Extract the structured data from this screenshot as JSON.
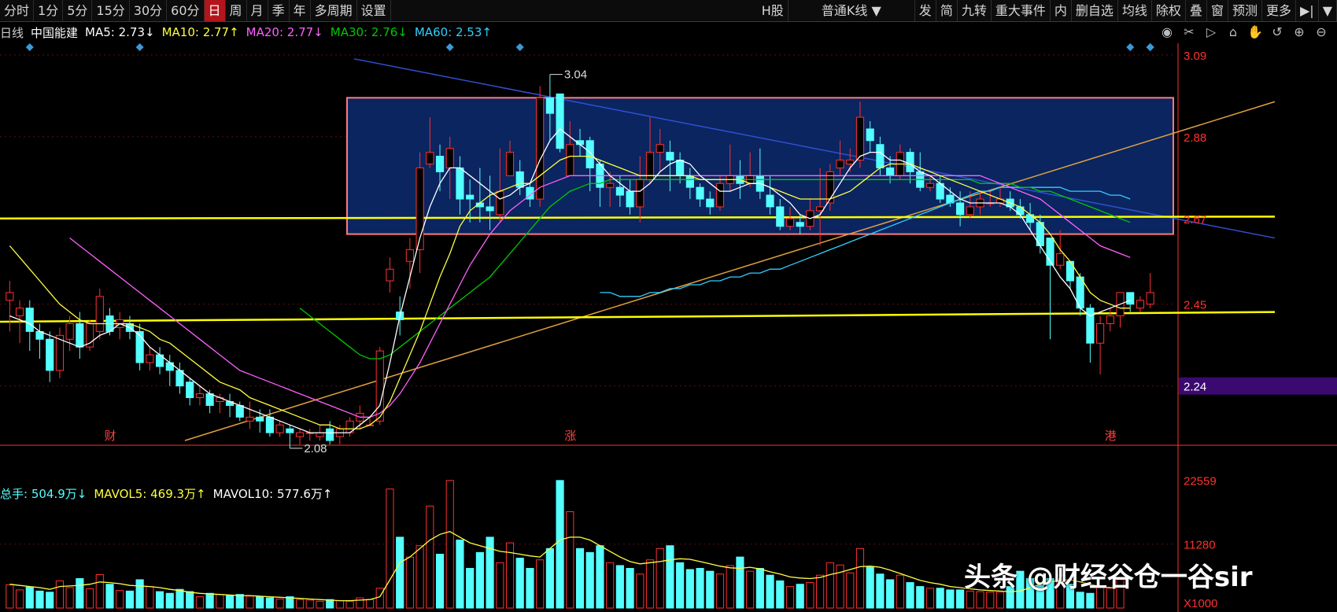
{
  "toolbar": {
    "left": [
      "分时",
      "1分",
      "5分",
      "15分",
      "30分",
      "60分",
      "日",
      "周",
      "月",
      "季",
      "年",
      "多周期",
      "设置"
    ],
    "active": "日",
    "market": "H股",
    "kline_type": "普通K线",
    "right": [
      "发",
      "简",
      "九转",
      "重大事件",
      "内",
      "删自选",
      "均线",
      "除权",
      "叠",
      "窗",
      "预测",
      "更多"
    ]
  },
  "legend": {
    "period": "日线",
    "stock": "中国能建",
    "ma5": "MA5: 2.73↓",
    "ma10": "MA10: 2.77↑",
    "ma20": "MA20: 2.77↓",
    "ma30": "MA30: 2.76↓",
    "ma60": "MA60: 2.53↑"
  },
  "vol_legend": {
    "total": "总手: 504.9万↓",
    "mavol5": "MAVOL5: 469.3万↑",
    "mavol10": "MAVOL10: 577.6万↑"
  },
  "colors": {
    "up": "#ff3030",
    "down": "#54ffff",
    "ma5": "#ffffff",
    "ma10": "#ffff40",
    "ma20": "#ff60ff",
    "ma30": "#00c800",
    "ma60": "#30d0ff",
    "box": "#0a2560",
    "box_border": "#ff7a7a",
    "hline": "#ffff00",
    "axis": "#ff3030"
  },
  "events": [
    "财",
    "涨",
    "港"
  ],
  "watermark": "头条 @财经谷仓一谷sir",
  "chart_data": {
    "type": "candlestick",
    "price_axis": {
      "ticks": [
        3.09,
        2.88,
        2.67,
        2.45,
        2.24
      ],
      "ylim": [
        2.1,
        3.12
      ],
      "highlight": 2.24
    },
    "volume_axis": {
      "ticks": [
        22559,
        11280
      ],
      "unit": "X1000"
    },
    "annotations": [
      {
        "label": "3.04",
        "value": 3.04
      },
      {
        "label": "2.08",
        "value": 2.08
      }
    ],
    "candles": [
      [
        2.46,
        2.48,
        2.51,
        2.38
      ],
      [
        2.42,
        2.44,
        2.46,
        2.35
      ],
      [
        2.44,
        2.38,
        2.46,
        2.33
      ],
      [
        2.38,
        2.36,
        2.4,
        2.31
      ],
      [
        2.36,
        2.28,
        2.38,
        2.25
      ],
      [
        2.28,
        2.37,
        2.39,
        2.26
      ],
      [
        2.36,
        2.4,
        2.42,
        2.33
      ],
      [
        2.4,
        2.34,
        2.43,
        2.31
      ],
      [
        2.34,
        2.4,
        2.41,
        2.33
      ],
      [
        2.38,
        2.47,
        2.49,
        2.36
      ],
      [
        2.42,
        2.38,
        2.44,
        2.37
      ],
      [
        2.39,
        2.41,
        2.43,
        2.36
      ],
      [
        2.4,
        2.38,
        2.42,
        2.36
      ],
      [
        2.38,
        2.3,
        2.4,
        2.28
      ],
      [
        2.3,
        2.32,
        2.34,
        2.28
      ],
      [
        2.32,
        2.29,
        2.34,
        2.27
      ],
      [
        2.3,
        2.28,
        2.32,
        2.24
      ],
      [
        2.28,
        2.24,
        2.3,
        2.22
      ],
      [
        2.25,
        2.21,
        2.26,
        2.19
      ],
      [
        2.21,
        2.22,
        2.24,
        2.19
      ],
      [
        2.22,
        2.19,
        2.23,
        2.17
      ],
      [
        2.2,
        2.21,
        2.22,
        2.17
      ],
      [
        2.2,
        2.19,
        2.22,
        2.16
      ],
      [
        2.19,
        2.16,
        2.2,
        2.15
      ],
      [
        2.15,
        2.16,
        2.2,
        2.13
      ],
      [
        2.16,
        2.15,
        2.18,
        2.12
      ],
      [
        2.16,
        2.12,
        2.18,
        2.11
      ],
      [
        2.12,
        2.14,
        2.15,
        2.11
      ],
      [
        2.13,
        2.12,
        2.14,
        2.08
      ],
      [
        2.11,
        2.12,
        2.13,
        2.09
      ],
      [
        2.12,
        2.12,
        2.13,
        2.1
      ],
      [
        2.11,
        2.12,
        2.14,
        2.1
      ],
      [
        2.13,
        2.1,
        2.15,
        2.09
      ],
      [
        2.11,
        2.13,
        2.14,
        2.09
      ],
      [
        2.12,
        2.15,
        2.16,
        2.11
      ],
      [
        2.15,
        2.17,
        2.19,
        2.13
      ],
      [
        2.14,
        2.14,
        2.16,
        2.14
      ],
      [
        2.15,
        2.33,
        2.34,
        2.14
      ],
      [
        2.51,
        2.54,
        2.57,
        2.48
      ],
      [
        2.43,
        2.41,
        2.47,
        2.37
      ],
      [
        2.56,
        2.59,
        2.62,
        2.49
      ],
      [
        2.59,
        2.8,
        2.84,
        2.53
      ],
      [
        2.81,
        2.84,
        2.93,
        2.8
      ],
      [
        2.83,
        2.79,
        2.86,
        2.74
      ],
      [
        2.8,
        2.85,
        2.88,
        2.72
      ],
      [
        2.8,
        2.72,
        2.83,
        2.68
      ],
      [
        2.73,
        2.72,
        2.77,
        2.66
      ],
      [
        2.71,
        2.7,
        2.8,
        2.66
      ],
      [
        2.7,
        2.69,
        2.78,
        2.64
      ],
      [
        2.68,
        2.74,
        2.85,
        2.66
      ],
      [
        2.78,
        2.84,
        2.87,
        2.78
      ],
      [
        2.79,
        2.75,
        2.82,
        2.73
      ],
      [
        2.75,
        2.72,
        2.76,
        2.7
      ],
      [
        2.72,
        2.98,
        3.01,
        2.7
      ],
      [
        2.98,
        2.94,
        3.04,
        2.87
      ],
      [
        2.99,
        2.85,
        2.99,
        2.84
      ],
      [
        2.78,
        2.86,
        2.92,
        2.78
      ],
      [
        2.87,
        2.86,
        2.9,
        2.83
      ],
      [
        2.87,
        2.8,
        2.88,
        2.74
      ],
      [
        2.81,
        2.75,
        2.82,
        2.7
      ],
      [
        2.75,
        2.76,
        2.79,
        2.7
      ],
      [
        2.75,
        2.73,
        2.78,
        2.7
      ],
      [
        2.74,
        2.7,
        2.77,
        2.68
      ],
      [
        2.7,
        2.77,
        2.83,
        2.66
      ],
      [
        2.77,
        2.84,
        2.93,
        2.76
      ],
      [
        2.84,
        2.86,
        2.9,
        2.79
      ],
      [
        2.84,
        2.82,
        2.87,
        2.74
      ],
      [
        2.82,
        2.78,
        2.84,
        2.76
      ],
      [
        2.78,
        2.75,
        2.8,
        2.72
      ],
      [
        2.75,
        2.72,
        2.76,
        2.7
      ],
      [
        2.72,
        2.7,
        2.74,
        2.68
      ],
      [
        2.7,
        2.76,
        2.78,
        2.69
      ],
      [
        2.76,
        2.78,
        2.86,
        2.74
      ],
      [
        2.78,
        2.76,
        2.82,
        2.72
      ],
      [
        2.76,
        2.78,
        2.84,
        2.75
      ],
      [
        2.78,
        2.74,
        2.85,
        2.72
      ],
      [
        2.73,
        2.7,
        2.78,
        2.68
      ],
      [
        2.7,
        2.65,
        2.72,
        2.64
      ],
      [
        2.65,
        2.67,
        2.7,
        2.64
      ],
      [
        2.66,
        2.65,
        2.68,
        2.63
      ],
      [
        2.65,
        2.69,
        2.72,
        2.64
      ],
      [
        2.69,
        2.7,
        2.8,
        2.6
      ],
      [
        2.71,
        2.79,
        2.81,
        2.69
      ],
      [
        2.8,
        2.82,
        2.87,
        2.78
      ],
      [
        2.81,
        2.82,
        2.85,
        2.79
      ],
      [
        2.82,
        2.93,
        2.97,
        2.8
      ],
      [
        2.9,
        2.87,
        2.92,
        2.84
      ],
      [
        2.86,
        2.8,
        2.88,
        2.78
      ],
      [
        2.8,
        2.78,
        2.83,
        2.76
      ],
      [
        2.78,
        2.84,
        2.86,
        2.77
      ],
      [
        2.84,
        2.79,
        2.85,
        2.76
      ],
      [
        2.79,
        2.75,
        2.84,
        2.74
      ],
      [
        2.75,
        2.76,
        2.78,
        2.74
      ],
      [
        2.76,
        2.72,
        2.78,
        2.71
      ],
      [
        2.73,
        2.71,
        2.75,
        2.7
      ],
      [
        2.71,
        2.68,
        2.74,
        2.65
      ],
      [
        2.68,
        2.7,
        2.74,
        2.67
      ],
      [
        2.7,
        2.72,
        2.74,
        2.68
      ],
      [
        2.71,
        2.71,
        2.74,
        2.7
      ],
      [
        2.71,
        2.72,
        2.75,
        2.7
      ],
      [
        2.72,
        2.7,
        2.74,
        2.69
      ],
      [
        2.7,
        2.68,
        2.72,
        2.67
      ],
      [
        2.68,
        2.66,
        2.71,
        2.64
      ],
      [
        2.66,
        2.6,
        2.68,
        2.58
      ],
      [
        2.62,
        2.55,
        2.6,
        2.36
      ],
      [
        2.55,
        2.58,
        2.64,
        2.54
      ],
      [
        2.56,
        2.51,
        2.56,
        2.49
      ],
      [
        2.52,
        2.44,
        2.53,
        2.42
      ],
      [
        2.44,
        2.35,
        2.45,
        2.3
      ],
      [
        2.35,
        2.4,
        2.42,
        2.27
      ],
      [
        2.4,
        2.42,
        2.44,
        2.38
      ],
      [
        2.42,
        2.48,
        2.48,
        2.39
      ],
      [
        2.48,
        2.45,
        2.48,
        2.43
      ],
      [
        2.44,
        2.46,
        2.47,
        2.43
      ],
      [
        2.45,
        2.48,
        2.53,
        2.44
      ]
    ],
    "volumes": [
      4100,
      3200,
      3700,
      3000,
      2800,
      4800,
      3600,
      5200,
      3400,
      5900,
      4200,
      3100,
      3000,
      5000,
      3800,
      2900,
      2600,
      3300,
      2900,
      2000,
      2600,
      2400,
      2200,
      2400,
      2100,
      2000,
      1800,
      1600,
      2000,
      1500,
      1400,
      1200,
      1500,
      1300,
      1200,
      1800,
      1500,
      3500,
      21000,
      12500,
      9000,
      11000,
      18000,
      9500,
      22500,
      12000,
      7000,
      9800,
      12500,
      8000,
      11500,
      8800,
      7000,
      8500,
      10500,
      22500,
      17000,
      10500,
      9800,
      11000,
      8000,
      7500,
      7000,
      6000,
      8500,
      10500,
      11000,
      8000,
      6800,
      7000,
      6500,
      6000,
      7500,
      9000,
      6500,
      7000,
      5800,
      4800,
      3800,
      4200,
      4500,
      5800,
      8000,
      7600,
      6200,
      10500,
      7200,
      6000,
      5000,
      5800,
      4500,
      3800,
      3500,
      3500,
      3200,
      3200,
      3000,
      2900,
      2800,
      2800,
      3800,
      6500,
      5200,
      4000,
      5200,
      5800,
      4200,
      2800,
      2600,
      3900,
      3500,
      5000
    ],
    "ma5": [
      2.42,
      2.41,
      2.4,
      2.38,
      2.37,
      2.36,
      2.35,
      2.34,
      2.35,
      2.37,
      2.38,
      2.4,
      2.39,
      2.37,
      2.34,
      2.32,
      2.3,
      2.28,
      2.26,
      2.24,
      2.22,
      2.21,
      2.2,
      2.19,
      2.18,
      2.17,
      2.16,
      2.15,
      2.14,
      2.13,
      2.12,
      2.12,
      2.12,
      2.12,
      2.12,
      2.14,
      2.16,
      2.19,
      2.3,
      2.42,
      2.52,
      2.62,
      2.7,
      2.76,
      2.8,
      2.8,
      2.78,
      2.76,
      2.74,
      2.72,
      2.73,
      2.75,
      2.76,
      2.82,
      2.87,
      2.9,
      2.88,
      2.86,
      2.84,
      2.81,
      2.78,
      2.76,
      2.74,
      2.74,
      2.76,
      2.79,
      2.81,
      2.82,
      2.81,
      2.78,
      2.76,
      2.74,
      2.74,
      2.75,
      2.76,
      2.76,
      2.75,
      2.73,
      2.71,
      2.68,
      2.67,
      2.68,
      2.72,
      2.76,
      2.8,
      2.83,
      2.84,
      2.84,
      2.82,
      2.82,
      2.81,
      2.79,
      2.78,
      2.76,
      2.74,
      2.72,
      2.71,
      2.71,
      2.71,
      2.71,
      2.7,
      2.68,
      2.64,
      2.6,
      2.56,
      2.52,
      2.49,
      2.44,
      2.42,
      2.43,
      2.44,
      2.45,
      2.46
    ],
    "ma10": [
      2.6,
      2.57,
      2.54,
      2.51,
      2.48,
      2.45,
      2.43,
      2.41,
      2.4,
      2.4,
      2.4,
      2.4,
      2.4,
      2.39,
      2.38,
      2.36,
      2.35,
      2.33,
      2.31,
      2.29,
      2.27,
      2.25,
      2.24,
      2.23,
      2.21,
      2.2,
      2.19,
      2.18,
      2.17,
      2.16,
      2.15,
      2.14,
      2.14,
      2.13,
      2.13,
      2.13,
      2.14,
      2.16,
      2.2,
      2.26,
      2.32,
      2.38,
      2.45,
      2.52,
      2.58,
      2.65,
      2.69,
      2.71,
      2.73,
      2.74,
      2.75,
      2.76,
      2.76,
      2.78,
      2.8,
      2.82,
      2.83,
      2.83,
      2.83,
      2.82,
      2.81,
      2.8,
      2.79,
      2.78,
      2.78,
      2.78,
      2.78,
      2.78,
      2.78,
      2.77,
      2.77,
      2.77,
      2.77,
      2.77,
      2.76,
      2.76,
      2.75,
      2.74,
      2.73,
      2.72,
      2.72,
      2.72,
      2.72,
      2.73,
      2.74,
      2.76,
      2.78,
      2.8,
      2.81,
      2.81,
      2.81,
      2.8,
      2.79,
      2.78,
      2.77,
      2.76,
      2.75,
      2.74,
      2.73,
      2.72,
      2.71,
      2.7,
      2.68,
      2.66,
      2.63,
      2.59,
      2.56,
      2.52,
      2.48,
      2.46,
      2.45,
      2.44,
      2.44
    ],
    "ma20": [
      null,
      null,
      null,
      null,
      null,
      null,
      2.62,
      2.6,
      2.58,
      2.56,
      2.54,
      2.52,
      2.5,
      2.48,
      2.46,
      2.44,
      2.42,
      2.4,
      2.38,
      2.36,
      2.34,
      2.32,
      2.3,
      2.28,
      2.27,
      2.26,
      2.25,
      2.24,
      2.23,
      2.22,
      2.21,
      2.2,
      2.19,
      2.18,
      2.17,
      2.16,
      2.16,
      2.17,
      2.19,
      2.22,
      2.26,
      2.3,
      2.35,
      2.4,
      2.45,
      2.5,
      2.55,
      2.59,
      2.63,
      2.66,
      2.69,
      2.71,
      2.73,
      2.75,
      2.76,
      2.77,
      2.78,
      2.78,
      2.78,
      2.78,
      2.78,
      2.78,
      2.78,
      2.78,
      2.78,
      2.78,
      2.78,
      2.78,
      2.78,
      2.78,
      2.78,
      2.78,
      2.78,
      2.78,
      2.78,
      2.78,
      2.78,
      2.78,
      2.78,
      2.78,
      2.78,
      2.78,
      2.78,
      2.78,
      2.78,
      2.78,
      2.78,
      2.78,
      2.78,
      2.78,
      2.78,
      2.78,
      2.78,
      2.78,
      2.78,
      2.78,
      2.78,
      2.78,
      2.77,
      2.76,
      2.75,
      2.74,
      2.73,
      2.72,
      2.7,
      2.68,
      2.66,
      2.64,
      2.62,
      2.6,
      2.59,
      2.58,
      2.57
    ],
    "ma30": [
      null,
      null,
      null,
      null,
      null,
      null,
      null,
      null,
      null,
      null,
      null,
      null,
      null,
      null,
      null,
      null,
      null,
      null,
      null,
      null,
      null,
      null,
      null,
      null,
      null,
      null,
      null,
      null,
      null,
      2.44,
      2.42,
      2.4,
      2.38,
      2.36,
      2.34,
      2.32,
      2.31,
      2.31,
      2.32,
      2.34,
      2.36,
      2.38,
      2.4,
      2.42,
      2.44,
      2.46,
      2.48,
      2.5,
      2.52,
      2.55,
      2.58,
      2.61,
      2.64,
      2.67,
      2.7,
      2.72,
      2.74,
      2.75,
      2.76,
      2.76,
      2.77,
      2.77,
      2.77,
      2.77,
      2.77,
      2.77,
      2.77,
      2.77,
      2.77,
      2.77,
      2.77,
      2.77,
      2.77,
      2.77,
      2.77,
      2.77,
      2.77,
      2.77,
      2.77,
      2.77,
      2.77,
      2.77,
      2.77,
      2.77,
      2.77,
      2.77,
      2.77,
      2.77,
      2.77,
      2.77,
      2.77,
      2.77,
      2.77,
      2.77,
      2.77,
      2.77,
      2.77,
      2.76,
      2.76,
      2.76,
      2.76,
      2.75,
      2.75,
      2.74,
      2.74,
      2.73,
      2.72,
      2.71,
      2.7,
      2.69,
      2.68,
      2.67,
      2.66
    ],
    "ma60": [
      null,
      null,
      null,
      null,
      null,
      null,
      null,
      null,
      null,
      null,
      null,
      null,
      null,
      null,
      null,
      null,
      null,
      null,
      null,
      null,
      null,
      null,
      null,
      null,
      null,
      null,
      null,
      null,
      null,
      null,
      null,
      null,
      null,
      null,
      null,
      null,
      null,
      null,
      null,
      null,
      null,
      null,
      null,
      null,
      null,
      null,
      null,
      null,
      null,
      null,
      null,
      null,
      null,
      null,
      null,
      null,
      null,
      null,
      null,
      2.48,
      2.48,
      2.47,
      2.47,
      2.47,
      2.48,
      2.48,
      2.49,
      2.49,
      2.5,
      2.5,
      2.51,
      2.51,
      2.52,
      2.52,
      2.53,
      2.53,
      2.54,
      2.54,
      2.55,
      2.56,
      2.57,
      2.58,
      2.59,
      2.6,
      2.61,
      2.62,
      2.63,
      2.64,
      2.65,
      2.66,
      2.67,
      2.68,
      2.69,
      2.7,
      2.71,
      2.72,
      2.73,
      2.74,
      2.74,
      2.75,
      2.75,
      2.75,
      2.75,
      2.75,
      2.75,
      2.75,
      2.74,
      2.74,
      2.74,
      2.74,
      2.73,
      2.73,
      2.72
    ],
    "mavol5": [
      4200,
      4000,
      3800,
      3600,
      3300,
      3800,
      3900,
      4000,
      4200,
      4600,
      4500,
      4300,
      4000,
      3900,
      3800,
      3600,
      3300,
      3100,
      2800,
      2600,
      2500,
      2400,
      2300,
      2200,
      2200,
      2100,
      2000,
      1900,
      1800,
      1700,
      1600,
      1500,
      1400,
      1300,
      1300,
      1400,
      1500,
      2000,
      5000,
      8000,
      9000,
      10500,
      12000,
      13000,
      13500,
      12500,
      11500,
      11000,
      10500,
      10000,
      9800,
      9500,
      9200,
      9000,
      10500,
      12000,
      12500,
      12500,
      12000,
      11000,
      10000,
      9000,
      8200,
      7800,
      8000,
      8200,
      8500,
      8700,
      8600,
      8200,
      7800,
      7400,
      7100,
      7000,
      7200,
      6900,
      6400,
      6000,
      5500,
      5300,
      5200,
      5400,
      5900,
      6300,
      6800,
      7300,
      7400,
      7200,
      6700,
      6100,
      5500,
      4900,
      4500,
      4200,
      3800,
      3600,
      3400,
      3200,
      3100,
      3000,
      2900,
      3000,
      3600,
      4200,
      4600,
      4900,
      5000,
      4600,
      4200,
      3800,
      3600,
      3800
    ]
  }
}
